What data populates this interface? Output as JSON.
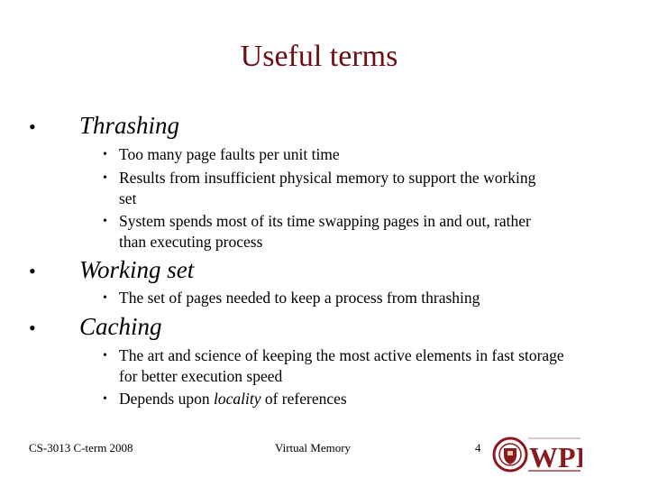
{
  "slide": {
    "title": "Useful terms",
    "sections": [
      {
        "term": "Thrashing",
        "bullets": [
          "Too many page faults per unit time",
          "Results from insufficient physical memory to support the working set",
          "System spends most of its time swapping pages in and out, rather than executing process"
        ]
      },
      {
        "term": "Working set",
        "bullets": [
          "The set of pages needed to keep a process from thrashing"
        ]
      },
      {
        "term": "Caching",
        "bullets": [
          "The art and science of keeping the most active elements in fast storage for better execution speed",
          {
            "before": "Depends upon ",
            "emph": "locality",
            "after": " of references"
          }
        ]
      }
    ],
    "bullet_char": "•",
    "footer": {
      "course": "CS-3013 C-term 2008",
      "topic": "Virtual Memory",
      "page_number": "4",
      "logo_text": "WPI"
    },
    "colors": {
      "title": "#6b0f14",
      "logo": "#8b1a1f"
    }
  }
}
